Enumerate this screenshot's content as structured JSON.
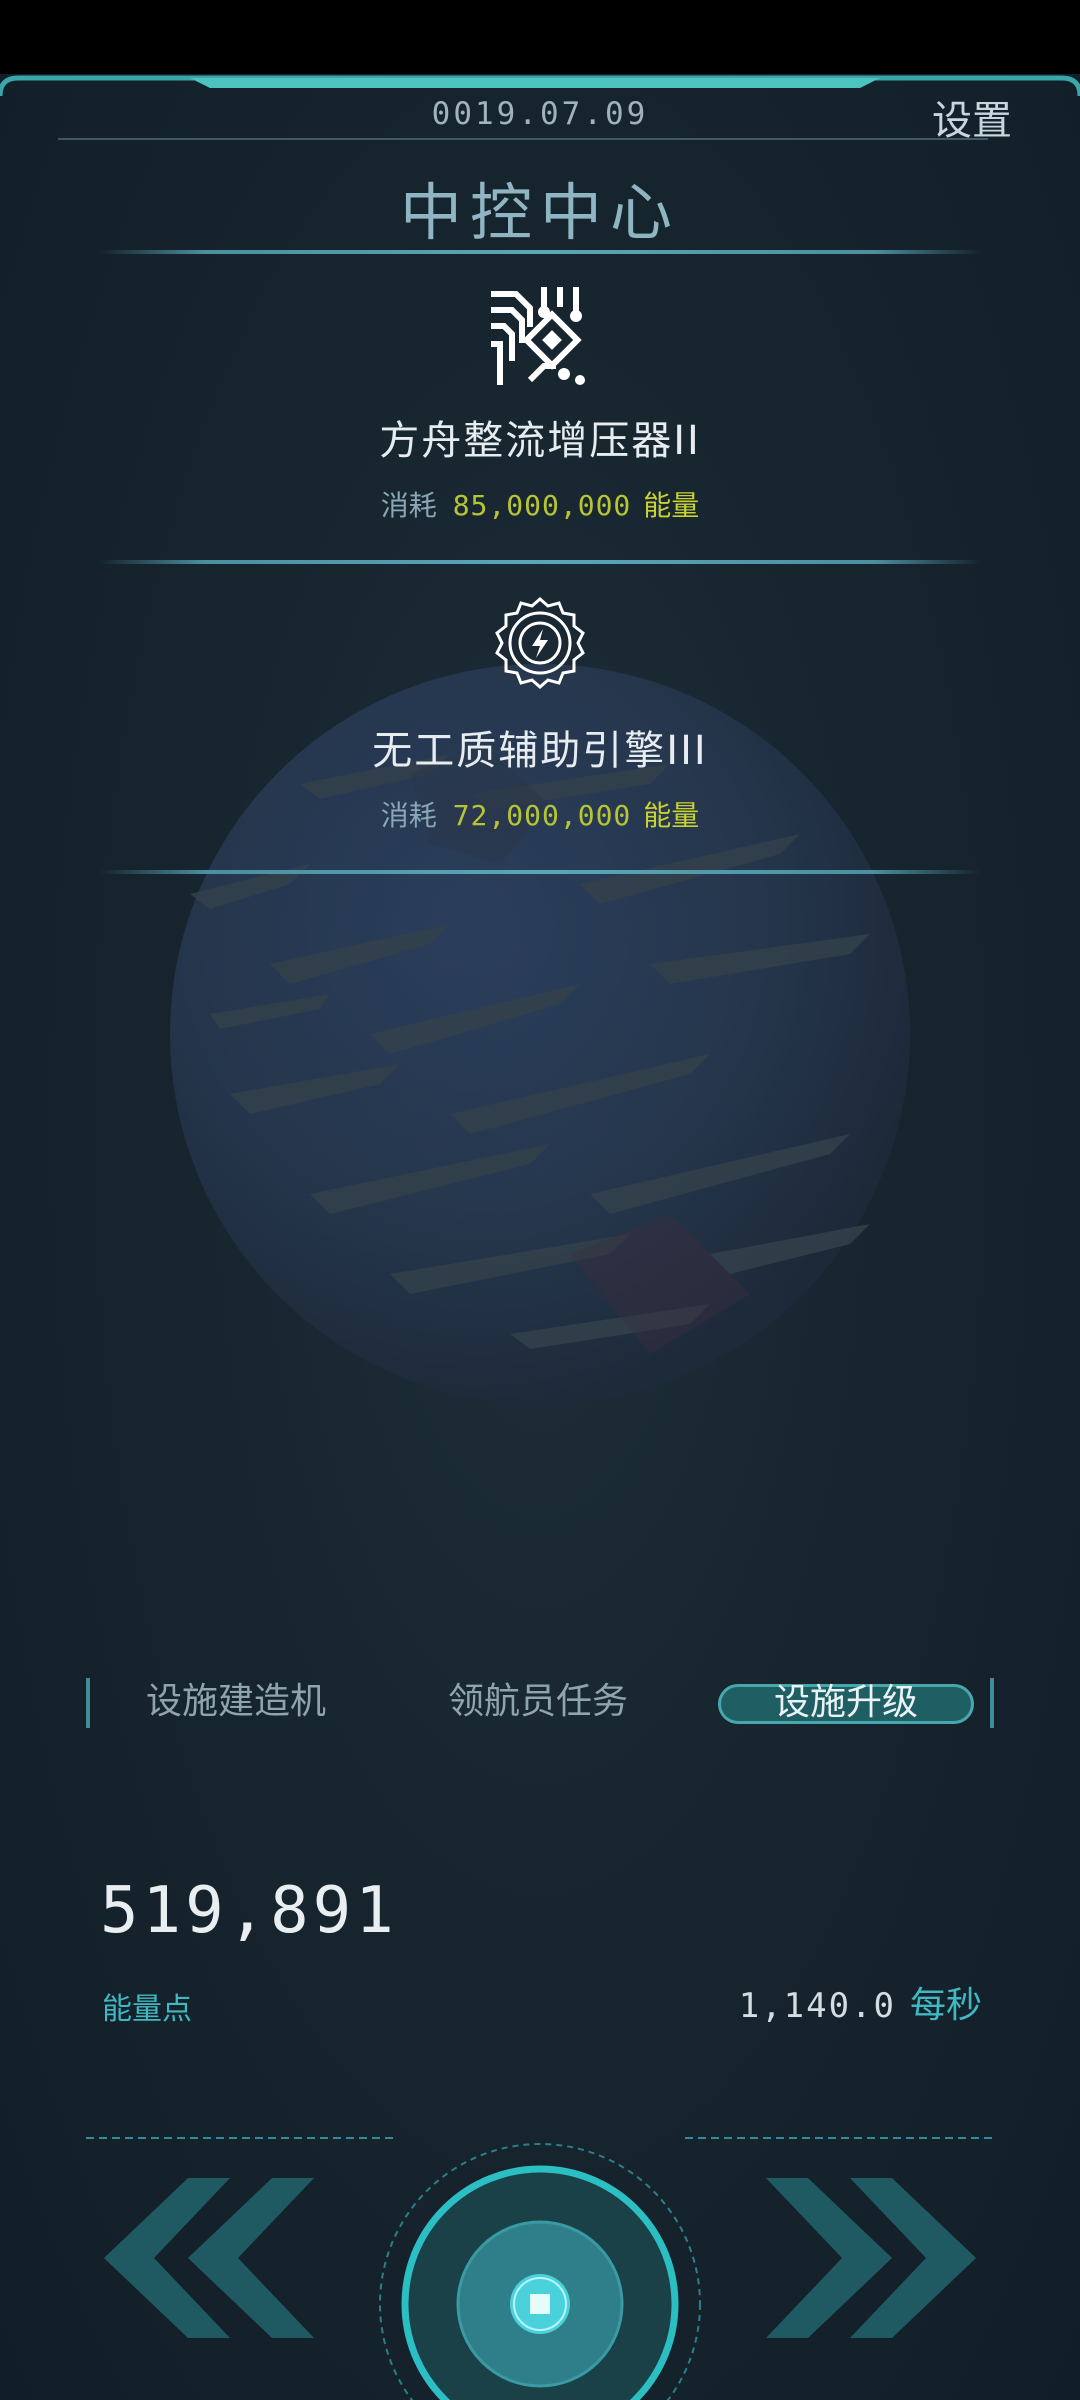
{
  "header": {
    "date": "0019.07.09",
    "settings_label": "设置",
    "title": "中控中心"
  },
  "upgrades": [
    {
      "icon": "circuit-chip-icon",
      "name": "方舟整流增压器II",
      "cost_label": "消耗",
      "cost_value": "85,000,000",
      "cost_unit": "能量"
    },
    {
      "icon": "lightning-gear-icon",
      "name": "无工质辅助引擎III",
      "cost_label": "消耗",
      "cost_value": "72,000,000",
      "cost_unit": "能量"
    }
  ],
  "tabs": [
    {
      "label": "设施建造机",
      "active": false
    },
    {
      "label": "领航员任务",
      "active": false
    },
    {
      "label": "设施升级",
      "active": true
    }
  ],
  "energy": {
    "value": "519,891",
    "label": "能量点",
    "rate_value": "1,140.0",
    "rate_unit": "每秒"
  },
  "controls": {
    "prev_icon": "double-chevron-left-icon",
    "center_icon": "core-button-icon",
    "next_icon": "double-chevron-right-icon"
  },
  "colors": {
    "accent": "#3fb8c2",
    "cost": "#b8c532",
    "panel": "#17252f"
  }
}
